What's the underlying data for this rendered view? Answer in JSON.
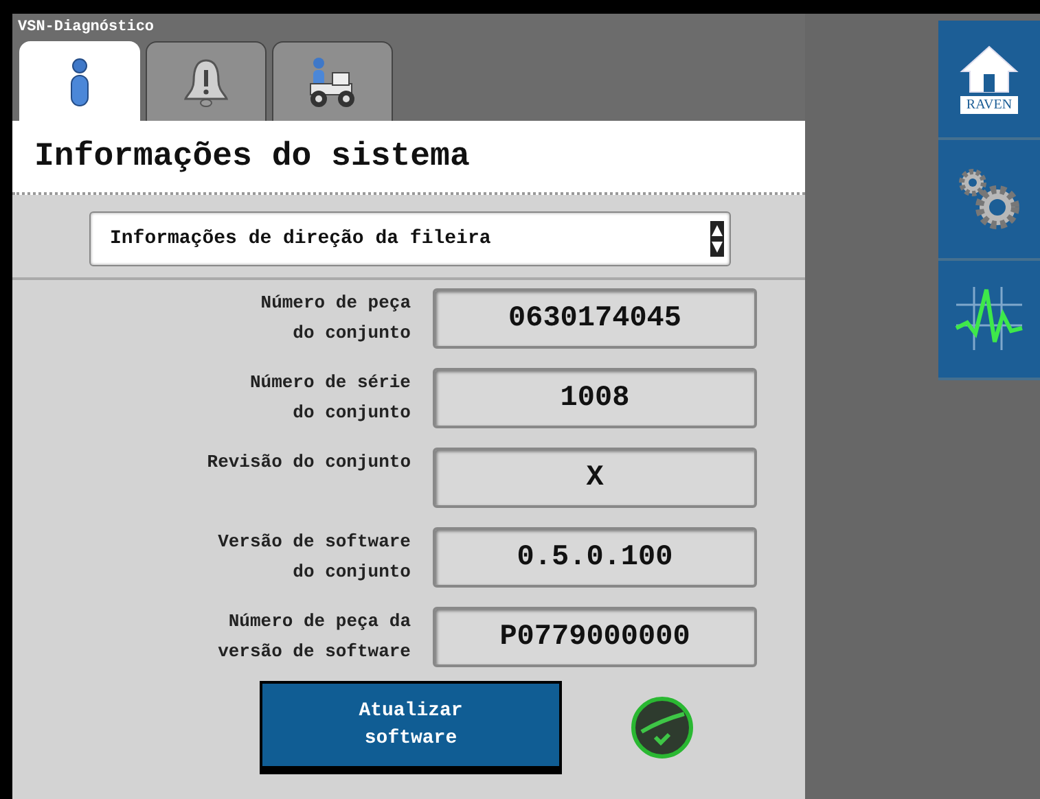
{
  "window": {
    "title": "VSN-Diagnóstico"
  },
  "tabs": [
    {
      "kind": "info",
      "selected": true
    },
    {
      "kind": "alarm",
      "selected": false
    },
    {
      "kind": "machine",
      "selected": false
    }
  ],
  "heading": "Informações do sistema",
  "dropdown": {
    "value": "Informações de direção da fileira"
  },
  "fields": [
    {
      "label": "Número de peça\ndo conjunto",
      "value": "0630174045"
    },
    {
      "label": "Número de série\ndo conjunto",
      "value": "1008"
    },
    {
      "label": "Revisão do conjunto",
      "value": "X"
    },
    {
      "label": "Versão de software\ndo conjunto",
      "value": "0.5.0.100"
    },
    {
      "label": "Número de peça da\nversão de software",
      "value": "P0779000000"
    }
  ],
  "update_button": "Atualizar\nsoftware",
  "status": {
    "ok": true
  },
  "side_buttons": [
    {
      "kind": "home",
      "label": "RAVEN"
    },
    {
      "kind": "settings"
    },
    {
      "kind": "diagnostics"
    }
  ]
}
